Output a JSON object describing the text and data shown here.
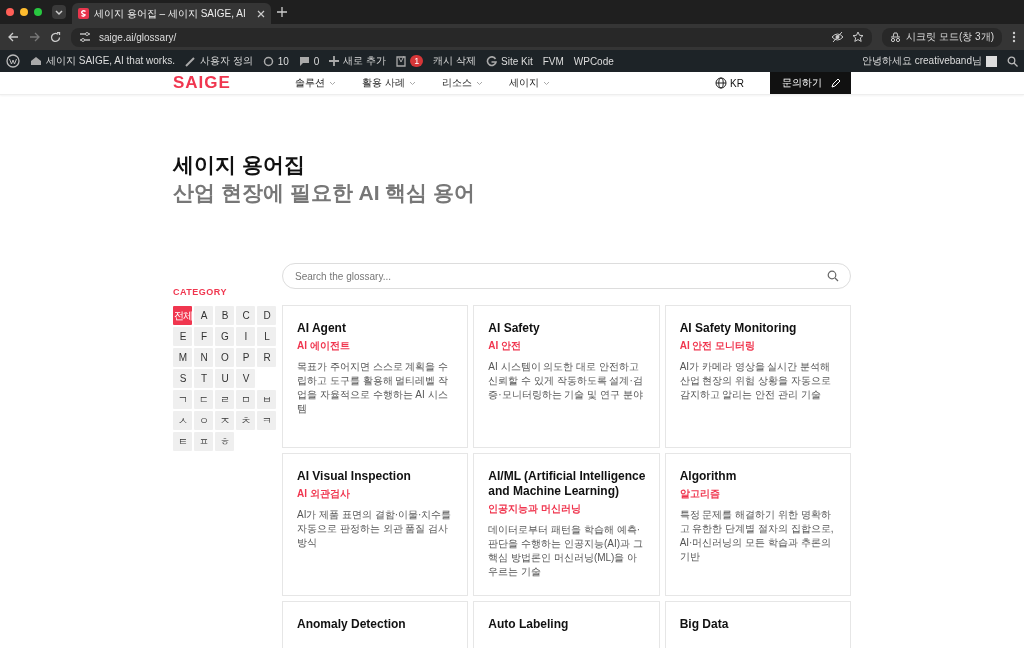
{
  "browser": {
    "tabs": [
      {
        "title": "세이지 용어집 – 세이지 SAIGE, AI",
        "selected": true
      }
    ],
    "url": "saige.ai/glossary/",
    "profile": "시크릿 모드(창 3개)"
  },
  "admin_bar": {
    "items": [
      {
        "kind": "wp"
      },
      {
        "kind": "site",
        "label": "세이지 SAIGE, AI that works."
      },
      {
        "kind": "customize",
        "label": "사용자 정의"
      },
      {
        "kind": "updates",
        "label": "10"
      },
      {
        "kind": "comments",
        "label": "0"
      },
      {
        "kind": "new",
        "label": "새로 추가"
      },
      {
        "kind": "yoast",
        "label": "1"
      },
      {
        "kind": "text",
        "label": "캐시 삭제"
      },
      {
        "kind": "sitekit",
        "label": "Site Kit"
      },
      {
        "kind": "text",
        "label": "FVM"
      },
      {
        "kind": "text",
        "label": "WPCode"
      }
    ],
    "greeting": "안녕하세요 creativeband님"
  },
  "header": {
    "logo": "SAIGE",
    "nav": [
      {
        "label": "솔루션"
      },
      {
        "label": "활용 사례"
      },
      {
        "label": "리소스"
      },
      {
        "label": "세이지"
      }
    ],
    "language": "KR",
    "cta": "문의하기"
  },
  "hero": {
    "title": "세이지 용어집",
    "subtitle": "산업 현장에 필요한 AI 핵심 용어"
  },
  "search": {
    "placeholder": "Search the glossary..."
  },
  "category": {
    "label": "CATEGORY",
    "groups": [
      {
        "items": [
          {
            "label": "전체",
            "selected": true
          },
          {
            "label": "A",
            "selected": false
          },
          {
            "label": "B",
            "selected": false
          },
          {
            "label": "C",
            "selected": false
          },
          {
            "label": "D",
            "selected": false
          },
          {
            "label": "E",
            "selected": false
          },
          {
            "label": "F",
            "selected": false
          },
          {
            "label": "G",
            "selected": false
          },
          {
            "label": "I",
            "selected": false
          },
          {
            "label": "L",
            "selected": false
          },
          {
            "label": "M",
            "selected": false
          },
          {
            "label": "N",
            "selected": false
          },
          {
            "label": "O",
            "selected": false
          },
          {
            "label": "P",
            "selected": false
          },
          {
            "label": "R",
            "selected": false
          },
          {
            "label": "S",
            "selected": false
          },
          {
            "label": "T",
            "selected": false
          },
          {
            "label": "U",
            "selected": false
          },
          {
            "label": "V",
            "selected": false
          }
        ]
      },
      {
        "items": [
          {
            "label": "ㄱ",
            "selected": false
          },
          {
            "label": "ㄷ",
            "selected": false
          },
          {
            "label": "ㄹ",
            "selected": false
          },
          {
            "label": "ㅁ",
            "selected": false
          },
          {
            "label": "ㅂ",
            "selected": false
          },
          {
            "label": "ㅅ",
            "selected": false
          },
          {
            "label": "ㅇ",
            "selected": false
          },
          {
            "label": "ㅈ",
            "selected": false
          },
          {
            "label": "ㅊ",
            "selected": false
          },
          {
            "label": "ㅋ",
            "selected": false
          },
          {
            "label": "ㅌ",
            "selected": false
          },
          {
            "label": "ㅍ",
            "selected": false
          },
          {
            "label": "ㅎ",
            "selected": false
          }
        ]
      }
    ]
  },
  "terms": [
    {
      "title": "AI Agent",
      "korean": "AI 에이전트",
      "description": "목표가 주어지면 스스로 계획을 수립하고 도구를 활용해 멀티레벨 작업을 자율적으로 수행하는 AI 시스템"
    },
    {
      "title": "AI Safety",
      "korean": "AI 안전",
      "description": "AI 시스템이 의도한 대로 안전하고 신뢰할 수 있게 작동하도록 설계·검증·모니터링하는 기술 및 연구 분야"
    },
    {
      "title": "AI Safety Monitoring",
      "korean": "AI 안전 모니터링",
      "description": "AI가 카메라 영상을 실시간 분석해 산업 현장의 위험 상황을 자동으로 감지하고 알리는 안전 관리 기술"
    },
    {
      "title": "AI Visual Inspection",
      "korean": "AI 외관검사",
      "description": "AI가 제품 표면의 결함·이물·치수를 자동으로 판정하는 외관 품질 검사 방식"
    },
    {
      "title": "AI/ML (Artificial Intelligence and Machine Learning)",
      "korean": "인공지능과 머신러닝",
      "description": "데이터로부터 패턴을 학습해 예측·판단을 수행하는 인공지능(AI)과 그 핵심 방법론인 머신러닝(ML)을 아우르는 기술"
    },
    {
      "title": "Algorithm",
      "korean": "알고리즘",
      "description": "특정 문제를 해결하기 위한 명확하고 유한한 단계별 절차의 집합으로, AI·머신러닝의 모든 학습과 추론의 기반"
    },
    {
      "title": "Anomaly Detection"
    },
    {
      "title": "Auto Labeling"
    },
    {
      "title": "Big Data"
    }
  ]
}
